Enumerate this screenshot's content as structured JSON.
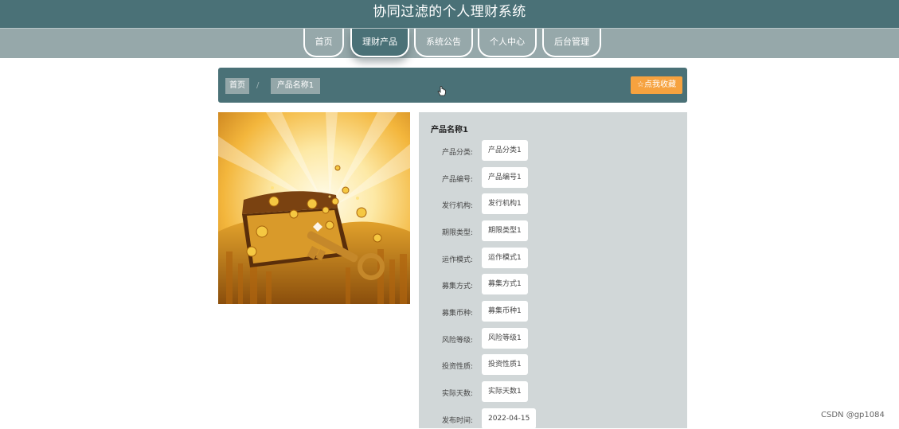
{
  "app": {
    "title": "协同过滤的个人理财系统"
  },
  "nav": {
    "items": [
      {
        "label": "首页",
        "active": false
      },
      {
        "label": "理财产品",
        "active": true
      },
      {
        "label": "系统公告",
        "active": false
      },
      {
        "label": "个人中心",
        "active": false
      },
      {
        "label": "后台管理",
        "active": false
      }
    ]
  },
  "breadcrumb": {
    "home": "首页",
    "separator": "/",
    "current": "产品名称1"
  },
  "favorite_button": {
    "icon": "star-outline-icon",
    "label": "☆点我收藏"
  },
  "product": {
    "name": "产品名称1",
    "image_description_icon": "treasure-chest-coins-key-image",
    "fields": [
      {
        "label": "产品分类:",
        "value": "产品分类1"
      },
      {
        "label": "产品编号:",
        "value": "产品编号1"
      },
      {
        "label": "发行机构:",
        "value": "发行机构1"
      },
      {
        "label": "期限类型:",
        "value": "期限类型1"
      },
      {
        "label": "运作模式:",
        "value": "运作模式1"
      },
      {
        "label": "募集方式:",
        "value": "募集方式1"
      },
      {
        "label": "募集币种:",
        "value": "募集币种1"
      },
      {
        "label": "风险等级:",
        "value": "风险等级1"
      },
      {
        "label": "投资性质:",
        "value": "投资性质1"
      },
      {
        "label": "实际天数:",
        "value": "实际天数1"
      },
      {
        "label": "发布时间:",
        "value": "2022-04-15"
      }
    ]
  },
  "watermark": "CSDN @gp1084",
  "colors": {
    "header": "#4a7177",
    "nav": "#96a8aa",
    "accent": "#f6a23f",
    "panel": "#d1d7d8"
  }
}
